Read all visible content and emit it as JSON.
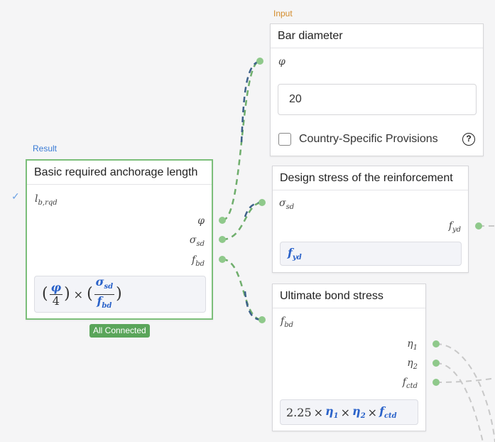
{
  "result_tag": "Result",
  "input_tag": "Input",
  "result_node": {
    "title": "Basic required anchorage length",
    "output_symbol": "l",
    "output_sub": "b,rqd",
    "inputs": [
      {
        "sym": "φ",
        "sub": ""
      },
      {
        "sym": "σ",
        "sub": "sd"
      },
      {
        "sym": "f",
        "sub": "bd"
      }
    ],
    "formula": {
      "phi": "φ",
      "four": "4",
      "times": "×",
      "sigma": "σ",
      "sigma_sub": "sd",
      "f": "f",
      "f_sub": "bd"
    },
    "status_badge": "All Connected"
  },
  "bar_node": {
    "title": "Bar diameter",
    "symbol": "φ",
    "value": "20",
    "checkbox_label": "Country-Specific Provisions",
    "help_glyph": "?"
  },
  "stress_node": {
    "title": "Design stress of the reinforcement",
    "output_symbol": "σ",
    "output_sub": "sd",
    "input_symbol": "f",
    "input_sub": "yd",
    "formula": {
      "f": "f",
      "sub": "yd"
    }
  },
  "bond_node": {
    "title": "Ultimate bond stress",
    "output_symbol": "f",
    "output_sub": "bd",
    "inputs": [
      {
        "sym": "η",
        "sub": "1"
      },
      {
        "sym": "η",
        "sub": "2"
      },
      {
        "sym": "f",
        "sub": "ctd"
      }
    ],
    "formula": {
      "coef": "2.25",
      "times": "×",
      "eta": "η",
      "eta1_sub": "1",
      "eta2_sub": "2",
      "f": "f",
      "f_sub": "ctd"
    }
  },
  "colors": {
    "wire_blue": "#3d6189",
    "wire_green": "#6fae6c",
    "wire_gray": "#c8c8c8",
    "port": "#8fc98b",
    "result_border": "#7cbf7a",
    "badge": "#5aa55a",
    "math_accent": "#2a62c9"
  }
}
